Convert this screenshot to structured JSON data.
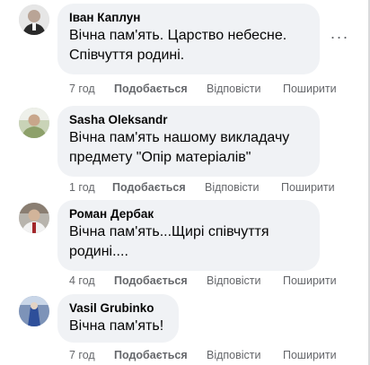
{
  "comments": [
    {
      "author": "Іван Каплун",
      "text_lines": [
        "Вічна пам'ять. Царство небесне.",
        "Співчуття родині."
      ],
      "time": "7 год",
      "like": "Подобається",
      "reply": "Відповісти",
      "share": "Поширити"
    },
    {
      "author": "Sasha Oleksandr",
      "text_lines": [
        "Вічна пам'ять нашому викладачу",
        "предмету \"Опір матеріалів\""
      ],
      "time": "1 год",
      "like": "Подобається",
      "reply": "Відповісти",
      "share": "Поширити"
    },
    {
      "author": "Роман Дербак",
      "text_lines": [
        "Вічна пам'ять...Щирі співчуття",
        "родині...."
      ],
      "time": "4 год",
      "like": "Подобається",
      "reply": "Відповісти",
      "share": "Поширити"
    },
    {
      "author": "Vasil Grubinko",
      "text_lines": [
        "Вічна пам'ять!"
      ],
      "time": "7 год",
      "like": "Подобається",
      "reply": "Відповісти",
      "share": "Поширити"
    }
  ],
  "more_button": "···",
  "colors": {
    "bubble": "#f0f2f5",
    "name": "#050505",
    "meta": "#65676b"
  }
}
